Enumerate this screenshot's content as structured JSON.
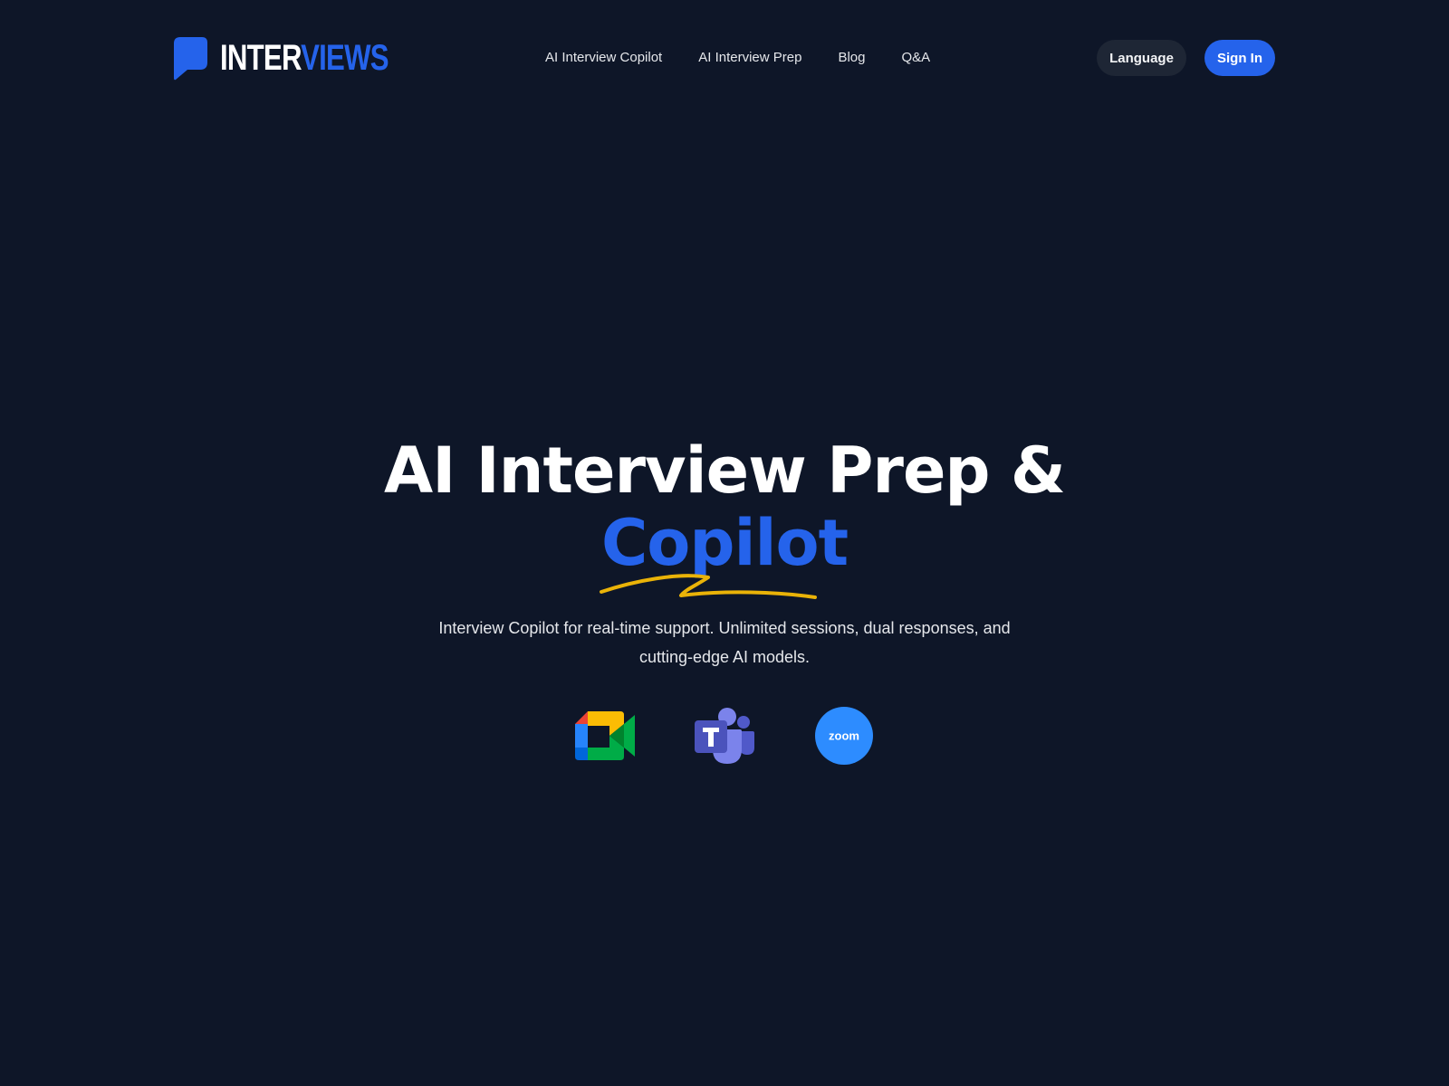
{
  "header": {
    "logo": {
      "part1": "INTER",
      "part2": "VIEWS",
      "icon": "speech-bubble-icon"
    },
    "nav": [
      {
        "label": "AI Interview Copilot"
      },
      {
        "label": "AI Interview Prep"
      },
      {
        "label": "Blog"
      },
      {
        "label": "Q&A"
      }
    ],
    "language_label": "Language",
    "signin_label": "Sign In"
  },
  "hero": {
    "title_line1": "AI Interview Prep &",
    "title_line2": "Copilot",
    "subtitle": "Interview Copilot for real-time support. Unlimited sessions, dual responses, and cutting-edge AI models.",
    "platforms": [
      {
        "name": "Google Meet",
        "icon": "google-meet-icon"
      },
      {
        "name": "Microsoft Teams",
        "icon": "microsoft-teams-icon"
      },
      {
        "name": "Zoom",
        "icon": "zoom-icon",
        "label": "zoom"
      }
    ]
  },
  "colors": {
    "background": "#0e1628",
    "accent": "#2563eb",
    "underline": "#eab308",
    "button_secondary": "#1e2635"
  }
}
